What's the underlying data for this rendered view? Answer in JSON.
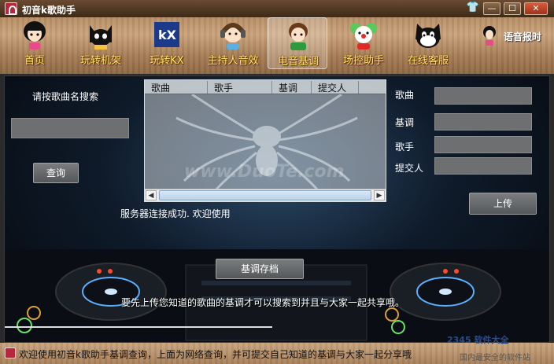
{
  "window": {
    "title": "初音k歌助手",
    "skin_glyph": "👕",
    "min_glyph": "—",
    "max_glyph": "☐",
    "close_glyph": "✕"
  },
  "toolbar": {
    "items": [
      {
        "label": "首页",
        "icon": "girl-avatar-icon"
      },
      {
        "label": "玩转机架",
        "icon": "black-cat-icon"
      },
      {
        "label": "玩转KX",
        "icon": "kx-logo-icon"
      },
      {
        "label": "主持人音效",
        "icon": "headphones-boy-icon"
      },
      {
        "label": "电音基调",
        "icon": "green-shirt-boy-icon",
        "active": true
      },
      {
        "label": "场控助手",
        "icon": "clown-icon"
      },
      {
        "label": "在线客服",
        "icon": "felix-cat-icon"
      }
    ],
    "voice_label": "语音报时"
  },
  "search": {
    "label": "请按歌曲名搜索",
    "value": "",
    "button": "查询"
  },
  "table": {
    "columns": [
      "歌曲",
      "歌手",
      "基调",
      "提交人"
    ],
    "rows": []
  },
  "status_message": "服务器连接成功. 欢迎使用",
  "form": {
    "song_label": "歌曲",
    "key_label": "基调",
    "singer_label": "歌手",
    "submitter_label": "提交人",
    "song_value": "",
    "key_value": "",
    "singer_value": "",
    "submitter_value": "",
    "upload_button": "上传"
  },
  "archive_button": "基调存档",
  "hint": "要先上传您知道的歌曲的基调才可以搜索到并且与大家一起共享哦。",
  "watermark": "www.DuoTe.com",
  "footer": {
    "text": "欢迎使用初音k歌助手基调查询，上面为网络查询，并可提交自己知道的基调与大家一起分享哦",
    "brand": "2345 软件大全",
    "brand_sub": "国内最安全的软件站"
  },
  "colors": {
    "accent_label": "#ffe56a",
    "wood": "#b78f67",
    "panel": "#0f1b2a"
  }
}
